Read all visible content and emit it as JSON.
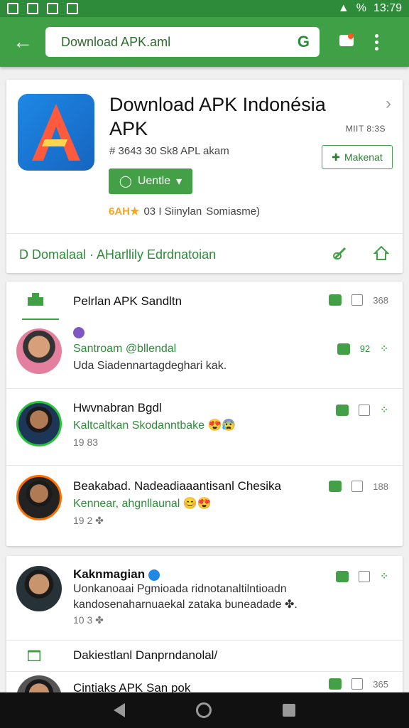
{
  "status": {
    "time": "13:79",
    "battery": "%"
  },
  "search": {
    "value": "Download APK.aml",
    "g": "G"
  },
  "header": {
    "title": "Download APK Indonésia APK",
    "version": "MIIT 8:3S",
    "meta": "# 3643 30 Sk8 APL akam",
    "follow_label": "Makenat",
    "install_label": "Uentle",
    "rating_stars": "6AH★",
    "rating_count": "03 I Siinylan",
    "rating_extra": "Somiasme)",
    "download_label": "D Domalaal · AHarllily Edrdnatoian"
  },
  "tab": {
    "label": "Pelrlan APK Sandltn",
    "count": "368"
  },
  "comments": [
    {
      "name": "",
      "badge": "purple-badge",
      "green": "Santroam @bllendal",
      "text": "Uda Siadennartagdeghari kak. ",
      "count": "92"
    },
    {
      "name": "Hwvnabran Bgdl",
      "green": "Kaltcaltkan Skodanntbake 😍😰",
      "small": "19 83"
    },
    {
      "name": "Beakabad. Nadeadiaaantisanl Chesika",
      "green": "Kennear, ahgnllaunal 😊😍",
      "small": "19 2 ✤",
      "count": "188"
    },
    {
      "name": "Kaknmagian",
      "text1": "Uonkanoaai Pgmioada ridnotanaltilntioadn",
      "text2": "kandosenaharnuaekal zataka buneadade ✤.",
      "small": "10 3 ✤"
    }
  ],
  "section": {
    "label": "Dakiestlanl Danprndanolal/"
  },
  "last": {
    "name": "Cintiaks APK San pok",
    "count": "365"
  },
  "colors": {
    "green": "#3fa046",
    "dark_green": "#2e8b3a"
  }
}
